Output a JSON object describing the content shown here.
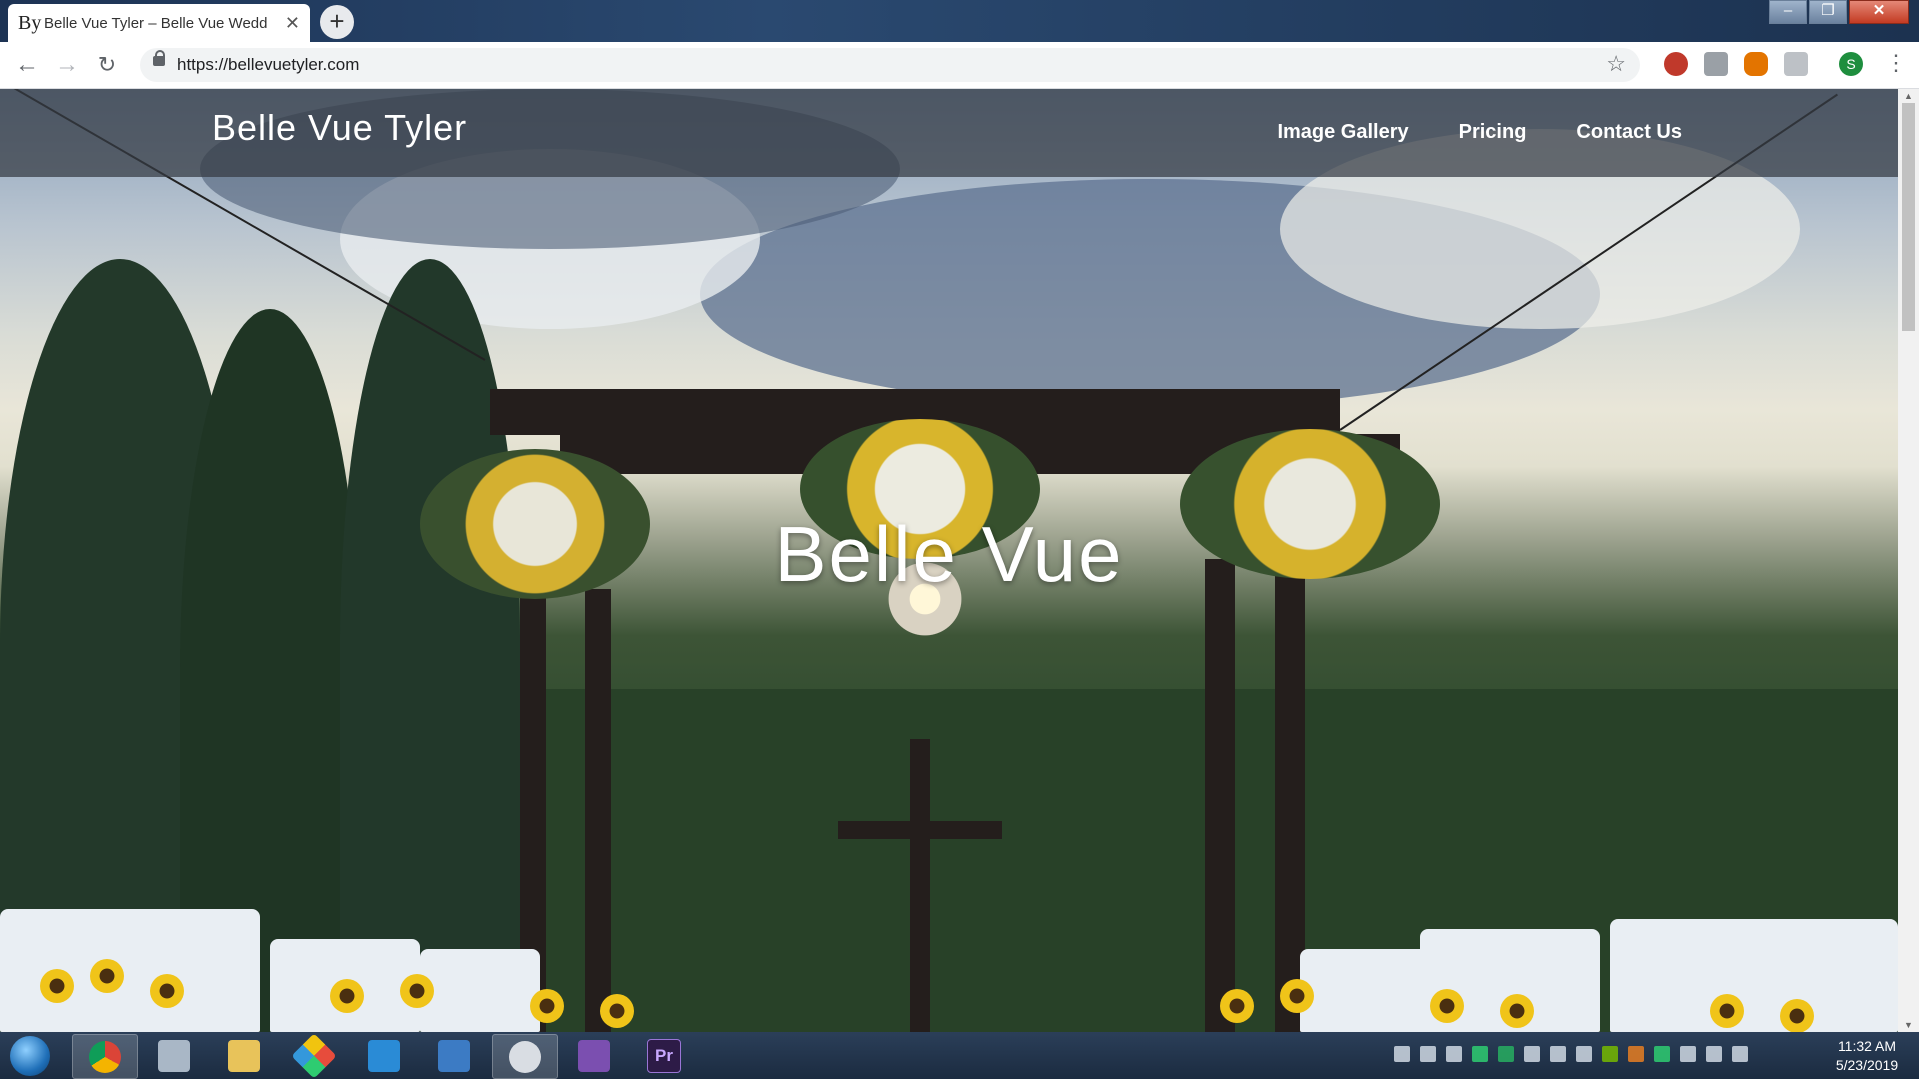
{
  "browser": {
    "tab": {
      "favicon": "By",
      "title": "Belle Vue Tyler – Belle Vue Wedd",
      "close": "✕"
    },
    "new_tab": "+",
    "window_controls": {
      "minimize": "–",
      "maximize": "❐",
      "close": "✕"
    },
    "url": "https://bellevuetyler.com",
    "profile_initial": "S",
    "icons": [
      "back-icon",
      "forward-icon",
      "reload-icon",
      "lock-icon",
      "star-icon",
      "extension-icons",
      "profile-avatar",
      "menu-icon"
    ]
  },
  "site": {
    "title": "Belle Vue Tyler",
    "nav": [
      {
        "label": "Image Gallery"
      },
      {
        "label": "Pricing"
      },
      {
        "label": "Contact Us"
      }
    ],
    "hero_title": "Belle Vue"
  },
  "taskbar": {
    "clock": {
      "time": "11:32 AM",
      "date": "5/23/2019"
    },
    "apps": [
      "Chrome",
      "Calculator",
      "File Explorer",
      "Git Extensions",
      "VS Code",
      "PowerShell",
      "Snipping Tool",
      "Visual Studio",
      "Premiere Pro"
    ],
    "premiere_label": "Pr"
  },
  "colors": {
    "header_overlay": "#343a42",
    "taskbar": "#1b2b40",
    "profile": "#1e8e3e"
  }
}
